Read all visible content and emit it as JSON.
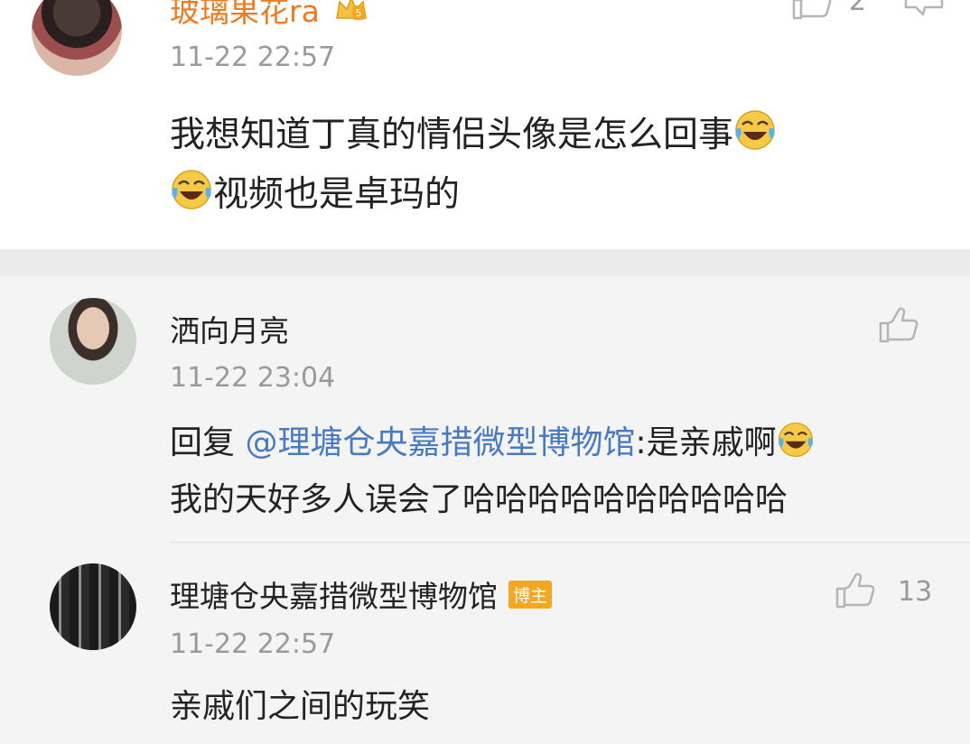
{
  "main_comment": {
    "username": "玻璃果花ra",
    "time": "11-22 22:57",
    "like_count": "2",
    "content_line1": "我想知道丁真的情侣头像是怎么回事",
    "content_line2": "视频也是卓玛的"
  },
  "replies": [
    {
      "username": "洒向月亮",
      "time": "11-22 23:04",
      "reply_prefix": "回复 ",
      "mention": "@理塘仓央嘉措微型博物馆",
      "reply_text": ":是亲戚啊",
      "line2": "我的天好多人误会了哈哈哈哈哈哈哈哈哈哈"
    },
    {
      "username": "理塘仓央嘉措微型博物馆",
      "badge": "博主",
      "time": "11-22 22:57",
      "like_count": "13",
      "content": "亲戚们之间的玩笑"
    }
  ],
  "colors": {
    "mention": "#4a79c4",
    "vip_name": "#f07a1f",
    "badge": "#f5a623"
  },
  "icons": [
    "crown-icon",
    "thumbs-up-icon",
    "comment-icon",
    "laughing-crying-emoji"
  ]
}
